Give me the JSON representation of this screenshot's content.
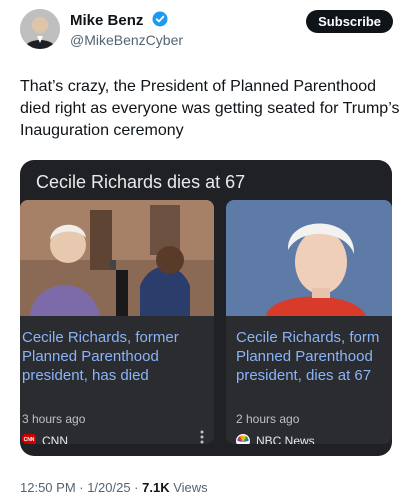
{
  "author": {
    "name": "Mike Benz",
    "handle": "@MikeBenzCyber"
  },
  "subscribe_label": "Subscribe",
  "tweet_text": "That’s crazy, the President of Planned Parenthood died right as everyone was getting seated for Trump’s Inauguration ceremony",
  "card": {
    "title": "Cecile Richards dies at 67",
    "stories": [
      {
        "headline_lines": [
          "Cecile Richards, former",
          "Planned Parenthood",
          "president, has died"
        ],
        "time": "3 hours ago",
        "source": "CNN",
        "source_logo_text": "CNN"
      },
      {
        "headline_lines": [
          "Cecile Richards, form",
          "Planned Parenthood",
          "president, dies at 67"
        ],
        "time": "2 hours ago",
        "source": "NBC News"
      }
    ]
  },
  "meta": {
    "time": "12:50 PM · 1/20/25 · ",
    "views_count": "7.1K",
    "views_label": " Views"
  },
  "colors": {
    "verified": "#1d9bf0",
    "card_bg": "#202124",
    "headline": "#8ab4f8",
    "cnn_red": "#cc0000"
  },
  "icons": [
    "verified-badge-icon",
    "kebab-menu-icon",
    "cnn-logo-icon",
    "nbc-peacock-icon"
  ]
}
